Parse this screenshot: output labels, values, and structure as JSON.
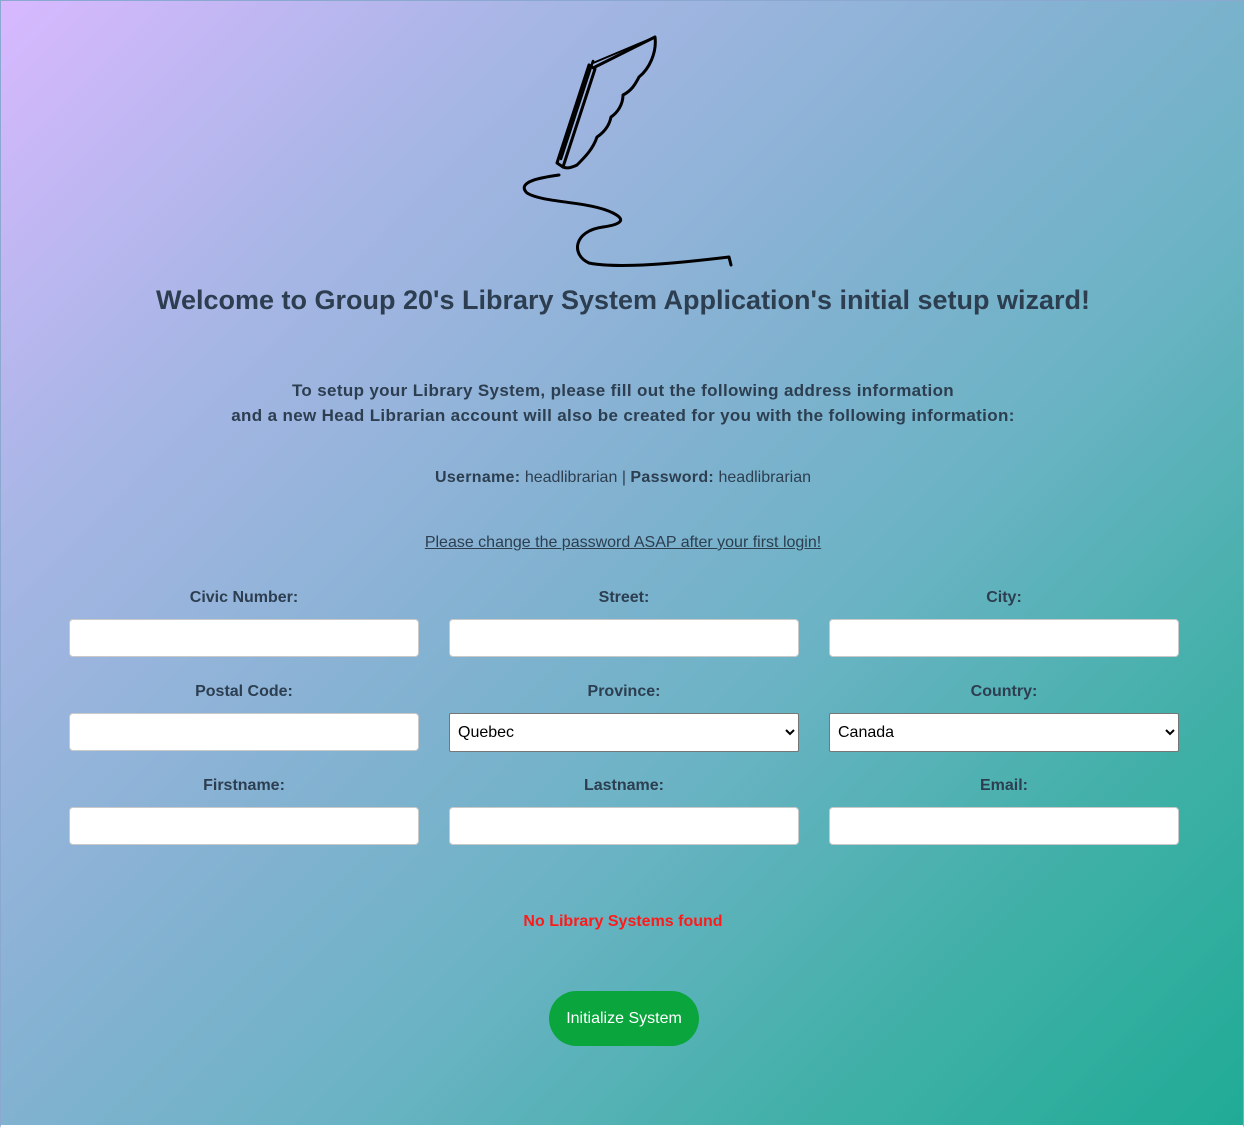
{
  "header": {
    "logo_icon": "quill-pen-signature-icon",
    "title": "Welcome to Group 20's Library System Application's initial setup wizard!"
  },
  "intro": {
    "line1": "To setup your Library System, please fill out the following address information",
    "line2": "and a new Head Librarian account will also be created for you with the following information:"
  },
  "credentials": {
    "username_label": "Username:",
    "username_value": "headlibrarian",
    "separator": "|",
    "password_label": "Password:",
    "password_value": "headlibrarian"
  },
  "warning": "Please change the password ASAP after your first login!",
  "form": {
    "civic_number": {
      "label": "Civic Number:",
      "value": ""
    },
    "street": {
      "label": "Street:",
      "value": ""
    },
    "city": {
      "label": "City:",
      "value": ""
    },
    "postal_code": {
      "label": "Postal Code:",
      "value": ""
    },
    "province": {
      "label": "Province:",
      "selected": "Quebec"
    },
    "country": {
      "label": "Country:",
      "selected": "Canada"
    },
    "firstname": {
      "label": "Firstname:",
      "value": ""
    },
    "lastname": {
      "label": "Lastname:",
      "value": ""
    },
    "email": {
      "label": "Email:",
      "value": ""
    }
  },
  "error_message": "No Library Systems found",
  "error_color": "#ff1a1a",
  "submit_label": "Initialize System",
  "submit_color": "#0aa53c"
}
